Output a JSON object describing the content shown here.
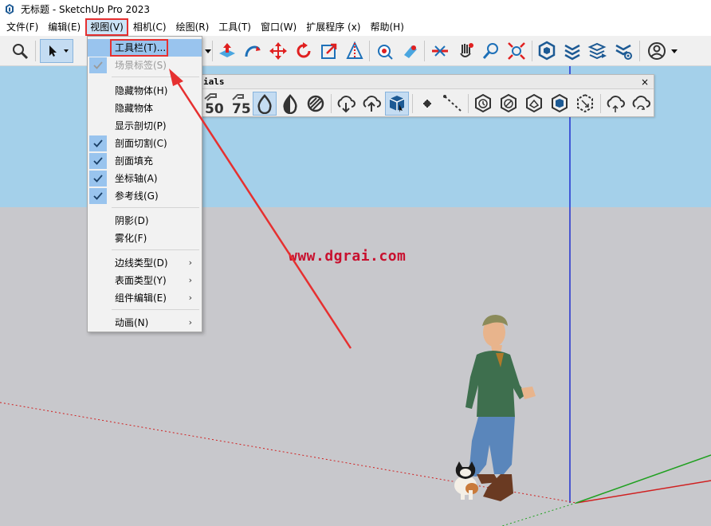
{
  "window": {
    "title": "无标题 - SketchUp Pro 2023",
    "app_icon": "sketchup-logo-icon"
  },
  "menubar": {
    "items": [
      {
        "label": "文件(F)"
      },
      {
        "label": "编辑(E)"
      },
      {
        "label": "视图(V)",
        "active": true
      },
      {
        "label": "相机(C)"
      },
      {
        "label": "绘图(R)"
      },
      {
        "label": "工具(T)"
      },
      {
        "label": "窗口(W)"
      },
      {
        "label": "扩展程序 (x)"
      },
      {
        "label": "帮助(H)"
      }
    ]
  },
  "toolbar": {
    "icons": [
      "zoom-icon",
      "select-arrow-icon",
      "dropdown-chevron-icon",
      "push-pull-icon",
      "follow-me-icon",
      "move-icon",
      "rotate-icon",
      "scale-icon",
      "tape-measure-icon",
      "paint-bucket-icon",
      "eraser-icon",
      "section-plane-icon",
      "orbit-icon",
      "pan-icon",
      "zoom-tool-icon",
      "zoom-extents-icon",
      "warehouse-icon",
      "extension-warehouse-icon",
      "layout-icon",
      "extension-manager-icon",
      "user-account-icon"
    ]
  },
  "styles_toolbar": {
    "title": "ials",
    "close_label": "×",
    "icons": [
      "face-style-50-icon",
      "face-style-75-icon",
      "monochrome-drop-icon",
      "shaded-drop-icon",
      "hatched-style-icon",
      "cloud-download-icon",
      "cloud-upload-icon",
      "materials-cube-icon",
      "point-icon",
      "dashed-line-icon",
      "hex-clock-icon",
      "hex-slash-icon",
      "hex-outline-icon",
      "hex-cube-icon",
      "hex-expand-icon",
      "cloud-sync-icon",
      "cloud-refresh-icon"
    ]
  },
  "view_menu": {
    "items": [
      {
        "label": "工具栏(T)...",
        "checked": false,
        "highlighted": true
      },
      {
        "label": "场景标签(S)",
        "checked": true,
        "disabled": true
      },
      {
        "label": "隐藏物体(H)",
        "checked": false
      },
      {
        "label": "隐藏物体",
        "checked": false
      },
      {
        "label": "显示剖切(P)",
        "checked": false
      },
      {
        "label": "剖面切割(C)",
        "checked": true
      },
      {
        "label": "剖面填充",
        "checked": true
      },
      {
        "label": "坐标轴(A)",
        "checked": true
      },
      {
        "label": "参考线(G)",
        "checked": true
      },
      {
        "label": "阴影(D)",
        "checked": false
      },
      {
        "label": "雾化(F)",
        "checked": false
      },
      {
        "label": "边线类型(D)",
        "submenu": true
      },
      {
        "label": "表面类型(Y)",
        "submenu": true
      },
      {
        "label": "组件编辑(E)",
        "submenu": true
      },
      {
        "label": "动画(N)",
        "submenu": true
      }
    ],
    "submenu_arrow": "›"
  },
  "viewport": {
    "sky_color": "#a4d0ea",
    "ground_color": "#c8c8cc",
    "axis_colors": {
      "red": "#d02020",
      "green": "#20a020",
      "blue": "#2030d0"
    }
  },
  "watermark": {
    "text": "www.dgrai.com"
  },
  "annotation": {
    "color": "#e63030"
  }
}
